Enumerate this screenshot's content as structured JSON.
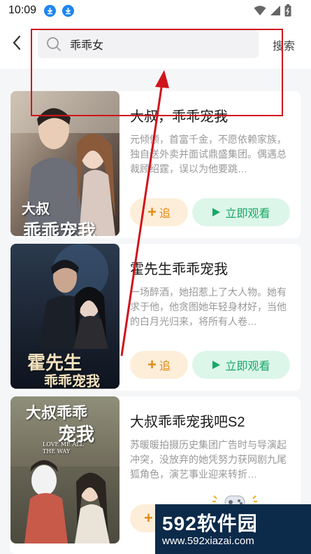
{
  "status_bar": {
    "time": "10:09"
  },
  "search": {
    "value": "乖乖女",
    "button_label": "搜索"
  },
  "results": [
    {
      "title": "大叔，乖乖宠我",
      "description": "元倾倾，首富千金，不愿依赖家族，独自送外卖并面试鼎盛集团。偶遇总裁顾绍霆，误以为他要跳…",
      "follow_label": "追",
      "watch_label": "立即观看",
      "poster_text_line1": "大叔",
      "poster_text_line2": "乖乖宠我"
    },
    {
      "title": "霍先生乖乖宠我",
      "description": "一场醉酒，她招惹上了大人物。她有求于他，他贪图她年轻身材好，当他的白月光归来，将所有人卷…",
      "follow_label": "追",
      "watch_label": "立即观看",
      "poster_text_line1": "霍先生",
      "poster_text_line2": "乖乖宠我"
    },
    {
      "title": "大叔乖乖宠我吧S2",
      "description": "苏暖暖拍摄历史集团广告时与导演起冲突，没放弃的她凭努力获网剧九尾狐角色，演艺事业迎来转折…",
      "follow_label": "追",
      "poster_text_line1": "大叔乖乖",
      "poster_text_line2": "宠我",
      "poster_text_small": "LOVE ME ALL THE WAY"
    }
  ],
  "watermark": {
    "main": "592软件园",
    "url": "www.592xiazai.com"
  },
  "colors": {
    "follow_bg": "#fdeed9",
    "follow_text": "#e38a14",
    "watch_bg": "#ddf6ea",
    "watch_text": "#17a866",
    "annotation": "#d0141c"
  }
}
